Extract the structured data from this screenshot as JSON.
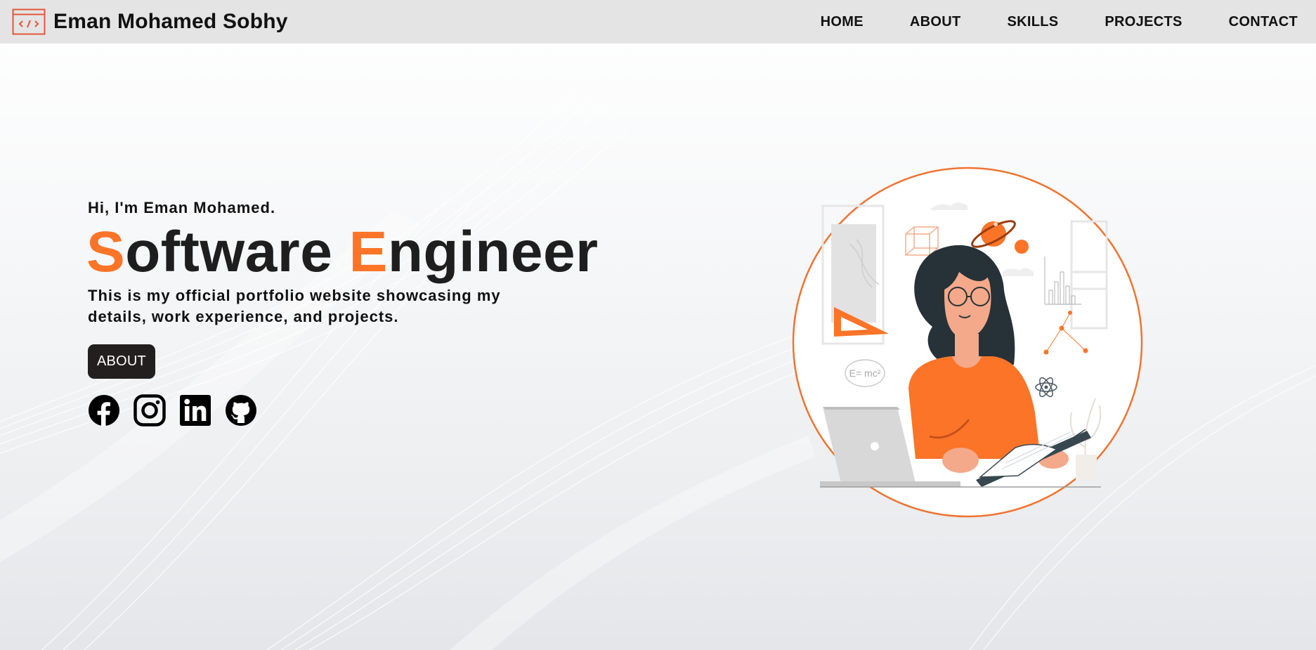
{
  "brand": {
    "name": "Eman Mohamed Sobhy",
    "icon": "code-window-icon"
  },
  "nav": {
    "items": [
      {
        "label": "HOME"
      },
      {
        "label": "ABOUT"
      },
      {
        "label": "SKILLS"
      },
      {
        "label": "PROJECTS"
      },
      {
        "label": "CONTACT"
      }
    ]
  },
  "hero": {
    "greeting": "Hi, I'm Eman Mohamed.",
    "title_word1_first": "S",
    "title_word1_rest": "oftware",
    "title_word2_first": "E",
    "title_word2_rest": "ngineer",
    "description": "This is my official portfolio website showcasing my details, work experience, and projects.",
    "cta_label": "ABOUT"
  },
  "socials": [
    {
      "icon": "facebook-icon"
    },
    {
      "icon": "instagram-icon"
    },
    {
      "icon": "linkedin-icon"
    },
    {
      "icon": "github-icon"
    }
  ],
  "illustration": {
    "formula": "E= mc²"
  },
  "colors": {
    "accent": "#fb7428",
    "dark": "#231f1e",
    "nav_bg": "#e4e4e4"
  }
}
